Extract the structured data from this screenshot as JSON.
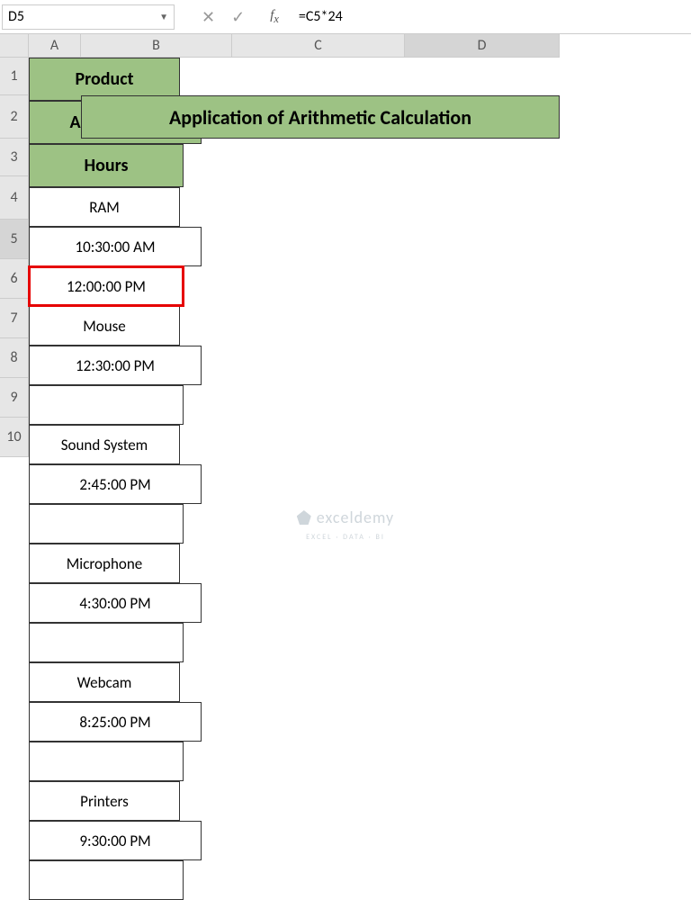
{
  "nameBox": "D5",
  "formula": "=C5*24",
  "columns": [
    {
      "label": "A",
      "width": 58
    },
    {
      "label": "B",
      "width": 168
    },
    {
      "label": "C",
      "width": 192
    },
    {
      "label": "D",
      "width": 172
    }
  ],
  "activeCol": "D",
  "rows": [
    {
      "label": "1",
      "height": 42
    },
    {
      "label": "2",
      "height": 48
    },
    {
      "label": "3",
      "height": 42
    },
    {
      "label": "4",
      "height": 48
    },
    {
      "label": "5",
      "height": 44
    },
    {
      "label": "6",
      "height": 44
    },
    {
      "label": "7",
      "height": 44
    },
    {
      "label": "8",
      "height": 44
    },
    {
      "label": "9",
      "height": 44
    },
    {
      "label": "10",
      "height": 44
    }
  ],
  "activeRow": "5",
  "title": "Application of Arithmetic Calculation",
  "headers": {
    "product": "Product",
    "arrival": "Arrival Time",
    "hours": "Hours"
  },
  "data": [
    {
      "product": "RAM",
      "arrival": "10:30:00 AM",
      "hours": "12:00:00 PM"
    },
    {
      "product": "Mouse",
      "arrival": "12:30:00 PM",
      "hours": ""
    },
    {
      "product": "Sound System",
      "arrival": "2:45:00 PM",
      "hours": ""
    },
    {
      "product": "Microphone",
      "arrival": "4:30:00 PM",
      "hours": ""
    },
    {
      "product": "Webcam",
      "arrival": "8:25:00 PM",
      "hours": ""
    },
    {
      "product": "Printers",
      "arrival": "9:30:00 PM",
      "hours": ""
    }
  ],
  "watermark": {
    "main": "exceldemy",
    "sub": "EXCEL · DATA · BI"
  },
  "chart_data": {
    "type": "table",
    "title": "Application of Arithmetic Calculation",
    "columns": [
      "Product",
      "Arrival Time",
      "Hours"
    ],
    "rows": [
      [
        "RAM",
        "10:30:00 AM",
        "12:00:00 PM"
      ],
      [
        "Mouse",
        "12:30:00 PM",
        ""
      ],
      [
        "Sound System",
        "2:45:00 PM",
        ""
      ],
      [
        "Microphone",
        "4:30:00 PM",
        ""
      ],
      [
        "Webcam",
        "8:25:00 PM",
        ""
      ],
      [
        "Printers",
        "9:30:00 PM",
        ""
      ]
    ]
  }
}
